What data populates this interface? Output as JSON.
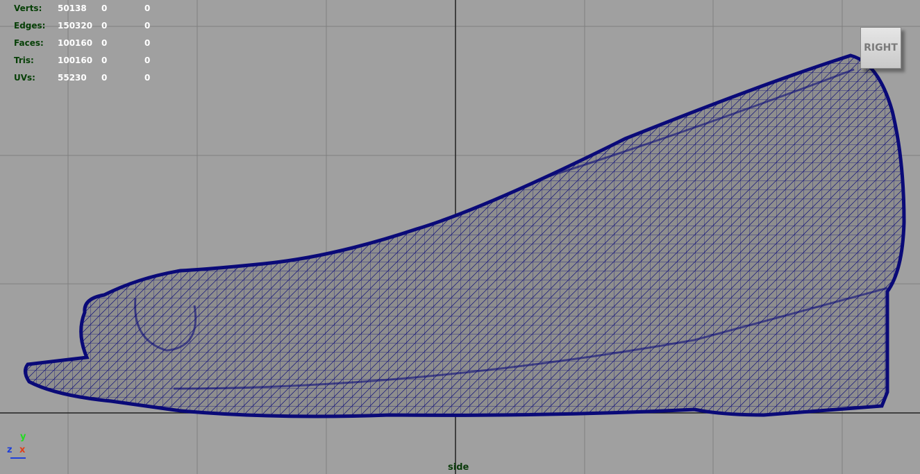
{
  "hud": {
    "rows": [
      {
        "label": "Verts:",
        "v1": "50138",
        "v2": "0",
        "v3": "0"
      },
      {
        "label": "Edges:",
        "v1": "150320",
        "v2": "0",
        "v3": "0"
      },
      {
        "label": "Faces:",
        "v1": "100160",
        "v2": "0",
        "v3": "0"
      },
      {
        "label": "Tris:",
        "v1": "100160",
        "v2": "0",
        "v3": "0"
      },
      {
        "label": "UVs:",
        "v1": "55230",
        "v2": "0",
        "v3": "0"
      }
    ]
  },
  "view_cube": {
    "label": "RIGHT"
  },
  "axis_indicator": {
    "y": "y",
    "z": "z",
    "x": "x"
  },
  "camera": {
    "name": "side"
  },
  "colors": {
    "background": "#a0a0a0",
    "grid": "#7f7f7f",
    "grid_axis": "#202020",
    "mesh_wire": "#0a0a78",
    "mesh_fill": "#8e8e8e"
  }
}
